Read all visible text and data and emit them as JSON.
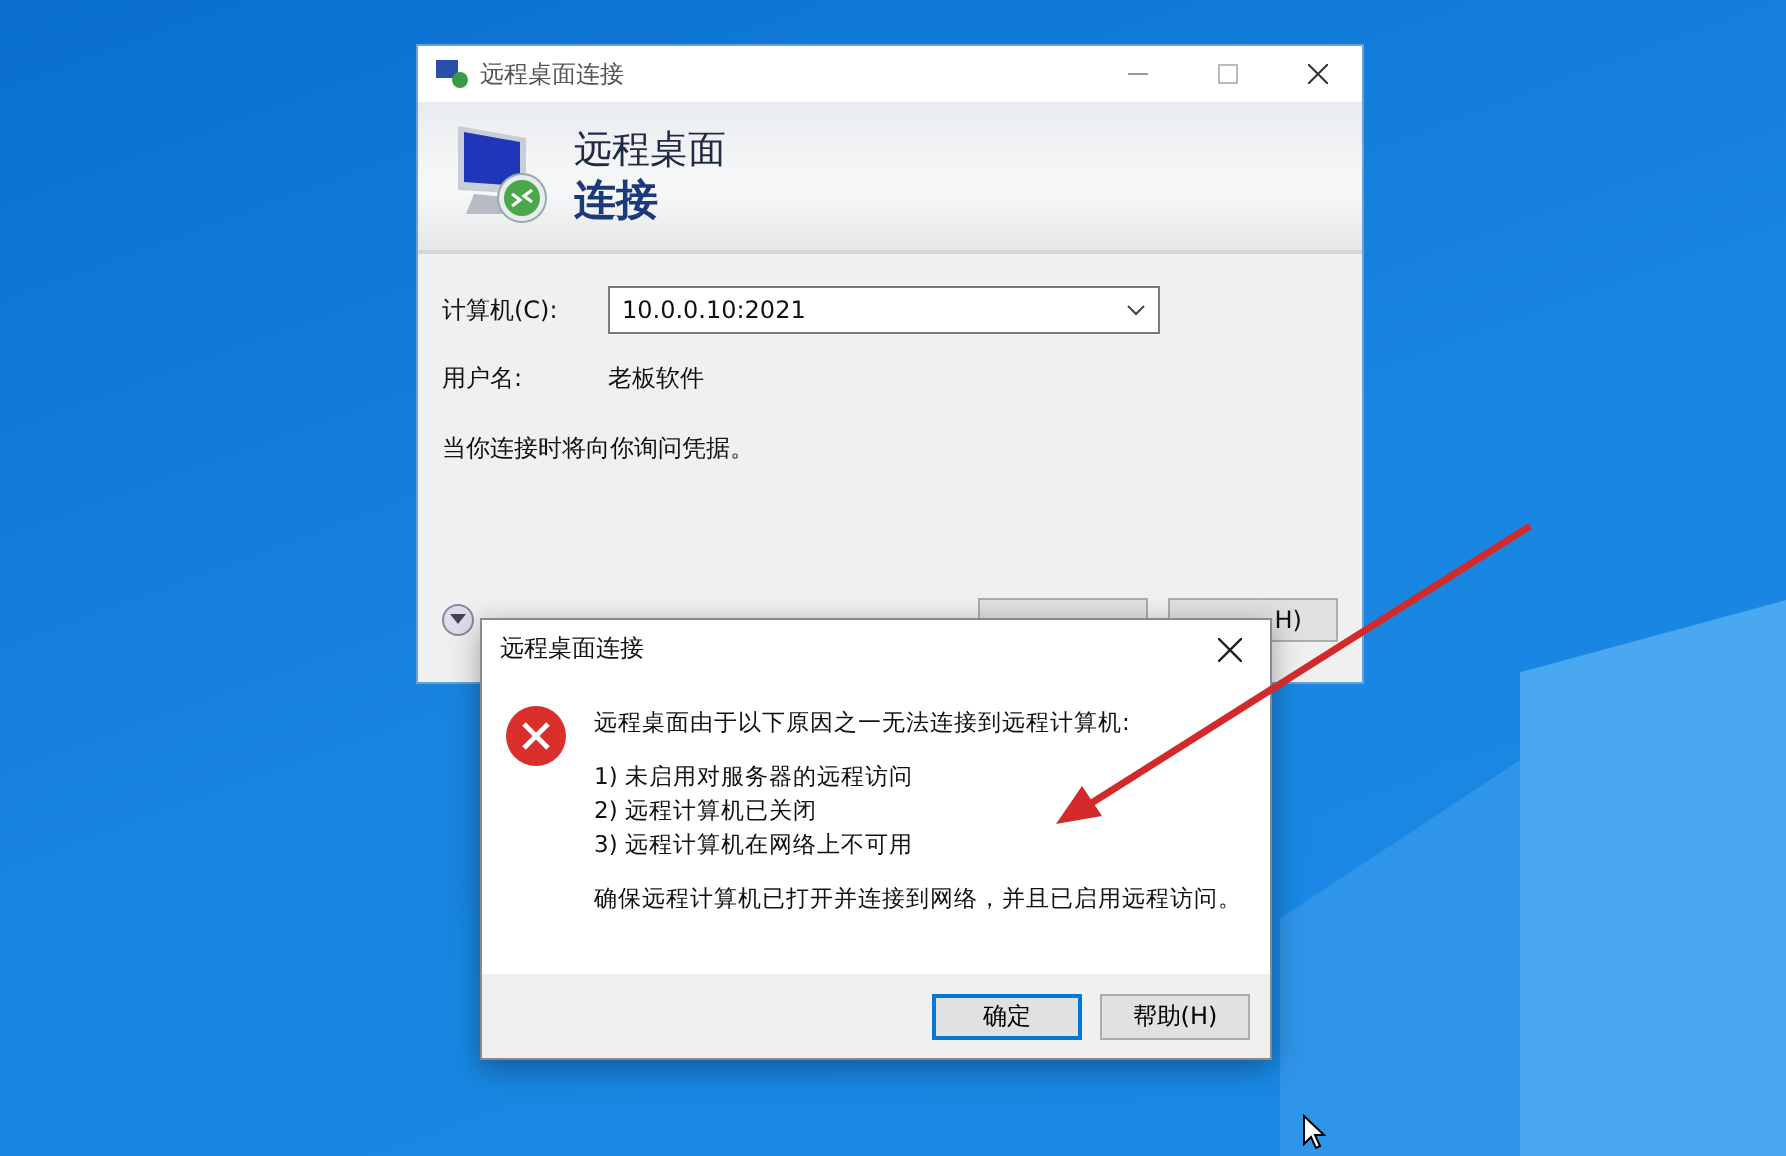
{
  "main_window": {
    "title": "远程桌面连接",
    "banner_line_1": "远程桌面",
    "banner_line_2": "连接",
    "computer_label": "计算机(C):",
    "computer_value": "10.0.0.10:2021",
    "username_label": "用户名:",
    "username_value": "老板软件",
    "note": "当你连接时将向你询问凭据。",
    "buttons": [
      {
        "label": "H)"
      }
    ]
  },
  "error_dialog": {
    "title": "远程桌面连接",
    "message": "远程桌面由于以下原因之一无法连接到远程计算机:",
    "reasons": [
      "1) 未启用对服务器的远程访问",
      "2) 远程计算机已关闭",
      "3) 远程计算机在网络上不可用"
    ],
    "hint": "确保远程计算机已打开并连接到网络，并且已启用远程访问。",
    "buttons": [
      {
        "label": "确定",
        "default": true
      },
      {
        "label": "帮助(H)",
        "default": false
      }
    ]
  }
}
